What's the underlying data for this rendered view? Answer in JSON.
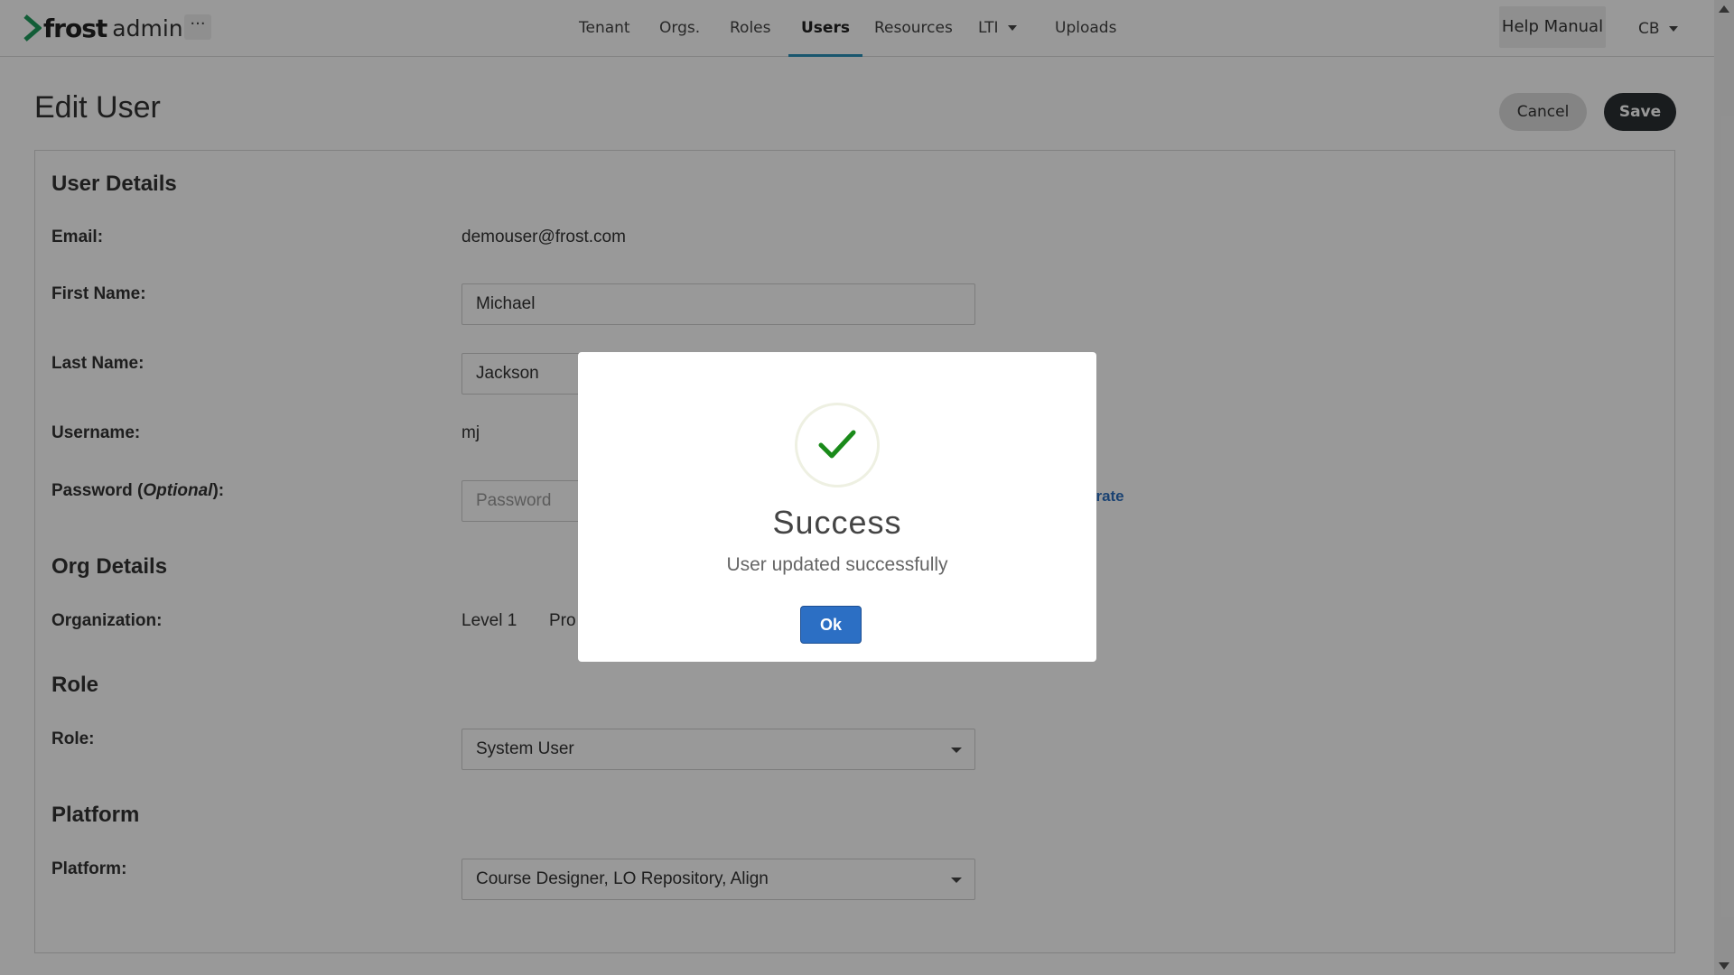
{
  "brand": {
    "name": "frost",
    "suffix": "admin",
    "accent_color": "#2a8fb8",
    "logo_color": "#1e9b5c"
  },
  "nav": {
    "more_label": "···",
    "links": [
      {
        "label": "Tenant"
      },
      {
        "label": "Orgs."
      },
      {
        "label": "Roles"
      },
      {
        "label": "Users",
        "active": true
      },
      {
        "label": "Resources"
      },
      {
        "label": "LTI",
        "dropdown": true
      },
      {
        "label": "Uploads"
      }
    ],
    "help_label": "Help Manual",
    "user_initials": "CB"
  },
  "page": {
    "title": "Edit User",
    "cancel_label": "Cancel",
    "save_label": "Save"
  },
  "form": {
    "user_details": {
      "heading": "User Details",
      "email_label": "Email:",
      "email_value": "demouser@frost.com",
      "first_name_label": "First Name:",
      "first_name_value": "Michael",
      "last_name_label": "Last Name:",
      "last_name_value": "Jackson",
      "username_label": "Username:",
      "username_value": "mj",
      "password_label_pre": "Password (",
      "password_label_opt": "Optional",
      "password_label_post": "):",
      "password_placeholder": "Password",
      "regenerate_label": "erate"
    },
    "org_details": {
      "heading": "Org Details",
      "organization_label": "Organization:",
      "org_level": "Level 1",
      "org_name_partial": "Pro"
    },
    "role": {
      "heading": "Role",
      "role_label": "Role:",
      "role_value": "System User"
    },
    "platform": {
      "heading": "Platform",
      "platform_label": "Platform:",
      "platform_value": "Course Designer, LO Repository, Align"
    }
  },
  "modal": {
    "title": "Success",
    "message": "User updated successfully",
    "ok_label": "Ok",
    "check_color": "#1a8a1a",
    "ok_color": "#2c6fc4"
  }
}
